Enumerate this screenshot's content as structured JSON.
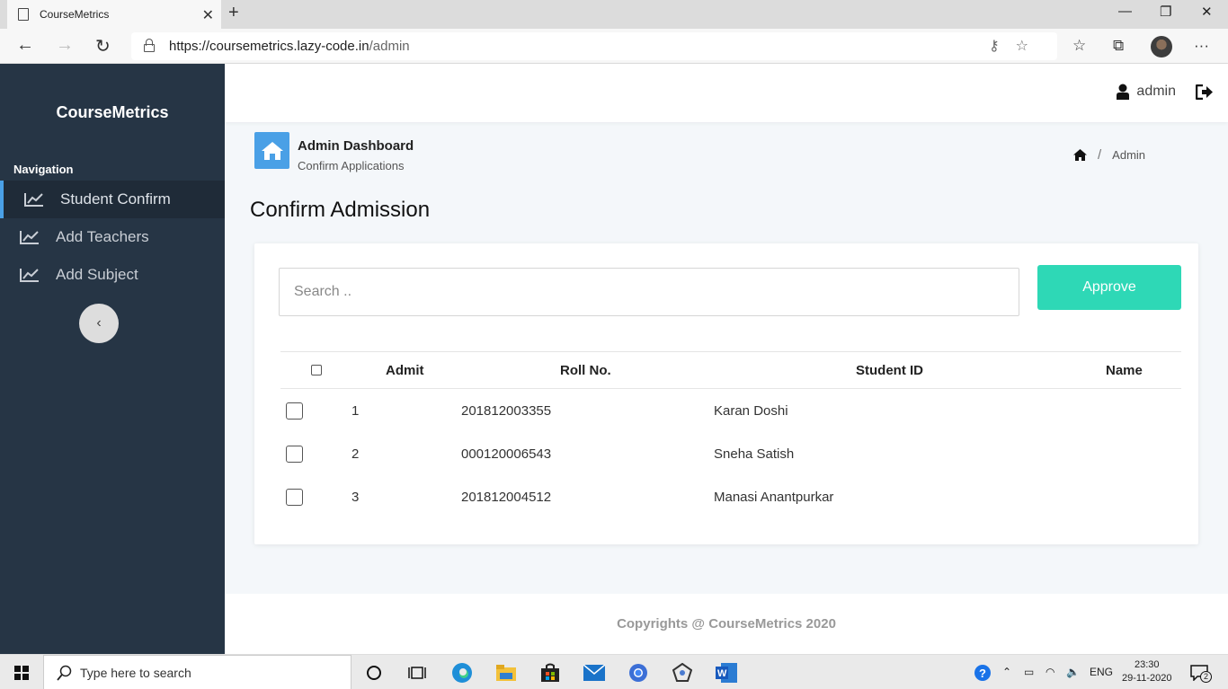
{
  "browser": {
    "tab_title": "CourseMetrics",
    "url_host": "https://coursemetrics.lazy-code.in",
    "url_path": "/admin"
  },
  "sidebar": {
    "brand": "CourseMetrics",
    "nav_label": "Navigation",
    "items": [
      {
        "label": "Student Confirm",
        "active": true
      },
      {
        "label": "Add Teachers",
        "active": false
      },
      {
        "label": "Add Subject",
        "active": false
      }
    ]
  },
  "header": {
    "username": "admin"
  },
  "page_header": {
    "title": "Admin Dashboard",
    "subtitle": "Confirm Applications",
    "breadcrumb_current": "Admin"
  },
  "main": {
    "heading": "Confirm Admission",
    "search_placeholder": "Search ..",
    "approve_label": "Approve",
    "columns": [
      "Admit",
      "Roll No.",
      "Student ID",
      "Name"
    ],
    "rows": [
      {
        "roll": "1",
        "student_id": "201812003355",
        "name": "Karan Doshi"
      },
      {
        "roll": "2",
        "student_id": "000120006543",
        "name": "Sneha Satish"
      },
      {
        "roll": "3",
        "student_id": "201812004512",
        "name": "Manasi Anantpurkar"
      }
    ]
  },
  "footer": {
    "text": "Copyrights @ CourseMetrics 2020"
  },
  "taskbar": {
    "search_placeholder": "Type here to search",
    "language": "ENG",
    "time": "23:30",
    "date": "29-11-2020",
    "notification_count": "2"
  },
  "colors": {
    "sidebar_bg": "#263545",
    "accent_blue": "#4aa0e6",
    "approve_green": "#2ed8b6"
  }
}
